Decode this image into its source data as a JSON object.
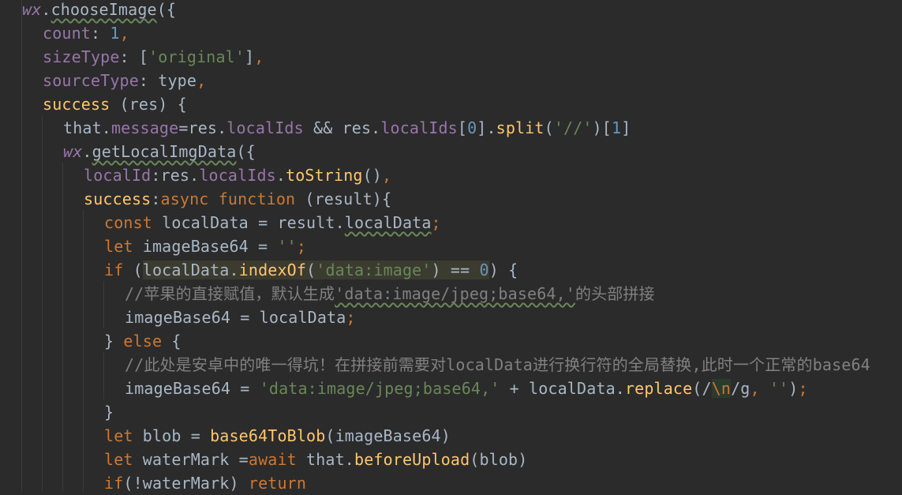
{
  "window": {
    "background": "#2b2b2b"
  },
  "colors": {
    "keyword": "#cc7832",
    "property": "#9876aa",
    "function": "#ffc66d",
    "number": "#6897bb",
    "string": "#6a8759",
    "comment": "#808080",
    "default": "#a9b7c6"
  },
  "code": {
    "lines": [
      {
        "name": "line-1",
        "tokens": [
          {
            "t": "wx",
            "c": "prop italic"
          },
          {
            "t": ".",
            "c": "plain"
          },
          {
            "t": "chooseImage",
            "c": "plain wavy"
          },
          {
            "t": "({",
            "c": "plain"
          }
        ]
      },
      {
        "name": "line-2",
        "tokens": [
          {
            "t": "count",
            "c": "prop"
          },
          {
            "t": ": ",
            "c": "plain"
          },
          {
            "t": "1",
            "c": "num"
          },
          {
            "t": ",",
            "c": "key"
          }
        ]
      },
      {
        "name": "line-3",
        "tokens": [
          {
            "t": "sizeType",
            "c": "prop"
          },
          {
            "t": ": [",
            "c": "plain"
          },
          {
            "t": "'original'",
            "c": "str"
          },
          {
            "t": "]",
            "c": "plain"
          },
          {
            "t": ",",
            "c": "key"
          }
        ]
      },
      {
        "name": "line-4",
        "tokens": [
          {
            "t": "sourceType",
            "c": "prop"
          },
          {
            "t": ": type",
            "c": "plain"
          },
          {
            "t": ",",
            "c": "key"
          }
        ]
      },
      {
        "name": "line-5",
        "tokens": [
          {
            "t": "success",
            "c": "fn"
          },
          {
            "t": " (res) {",
            "c": "plain"
          }
        ]
      },
      {
        "name": "line-6",
        "tokens": [
          {
            "t": "that.",
            "c": "plain"
          },
          {
            "t": "message",
            "c": "prop"
          },
          {
            "t": "=res.",
            "c": "plain"
          },
          {
            "t": "localIds",
            "c": "prop"
          },
          {
            "t": " && res.",
            "c": "plain"
          },
          {
            "t": "localIds",
            "c": "prop"
          },
          {
            "t": "[",
            "c": "plain"
          },
          {
            "t": "0",
            "c": "num"
          },
          {
            "t": "].",
            "c": "plain"
          },
          {
            "t": "split",
            "c": "fn"
          },
          {
            "t": "(",
            "c": "plain"
          },
          {
            "t": "'//'",
            "c": "str"
          },
          {
            "t": ")[",
            "c": "plain"
          },
          {
            "t": "1",
            "c": "num"
          },
          {
            "t": "]",
            "c": "plain"
          }
        ]
      },
      {
        "name": "line-7",
        "tokens": [
          {
            "t": "wx",
            "c": "prop italic"
          },
          {
            "t": ".",
            "c": "plain"
          },
          {
            "t": "getLocalImgData",
            "c": "plain wavy"
          },
          {
            "t": "({",
            "c": "plain"
          }
        ]
      },
      {
        "name": "line-8",
        "tokens": [
          {
            "t": "localId",
            "c": "prop"
          },
          {
            "t": ":res.",
            "c": "plain"
          },
          {
            "t": "localIds",
            "c": "prop"
          },
          {
            "t": ".",
            "c": "plain"
          },
          {
            "t": "toString",
            "c": "fn"
          },
          {
            "t": "()",
            "c": "plain"
          },
          {
            "t": ",",
            "c": "key"
          }
        ]
      },
      {
        "name": "line-9",
        "tokens": [
          {
            "t": "success",
            "c": "fn"
          },
          {
            "t": ":",
            "c": "plain"
          },
          {
            "t": "async function ",
            "c": "key"
          },
          {
            "t": "(result){",
            "c": "plain"
          }
        ]
      },
      {
        "name": "line-10",
        "tokens": [
          {
            "t": "const ",
            "c": "key"
          },
          {
            "t": "localData = result.",
            "c": "plain"
          },
          {
            "t": "localData",
            "c": "plain wavy"
          },
          {
            "t": ";",
            "c": "key"
          }
        ]
      },
      {
        "name": "line-11",
        "tokens": [
          {
            "t": "let ",
            "c": "key"
          },
          {
            "t": "imageBase64 = ",
            "c": "plain"
          },
          {
            "t": "''",
            "c": "str"
          },
          {
            "t": ";",
            "c": "key"
          }
        ]
      },
      {
        "name": "line-12",
        "tokens": [
          {
            "t": "if ",
            "c": "key"
          },
          {
            "t": "(",
            "c": "plain"
          },
          {
            "t": "localData.",
            "c": "plain hl"
          },
          {
            "t": "indexOf",
            "c": "fn hl"
          },
          {
            "t": "(",
            "c": "plain hl"
          },
          {
            "t": "'data:image'",
            "c": "str hl"
          },
          {
            "t": ") == ",
            "c": "plain hl"
          },
          {
            "t": "0",
            "c": "num hl"
          },
          {
            "t": ") {",
            "c": "plain"
          }
        ]
      },
      {
        "name": "line-13",
        "tokens": [
          {
            "t": "//苹果的直接赋值，默认生成",
            "c": "cmt"
          },
          {
            "t": "'data:image/jpeg;base64,'",
            "c": "cmt wavy"
          },
          {
            "t": "的头部拼接",
            "c": "cmt"
          }
        ]
      },
      {
        "name": "line-14",
        "tokens": [
          {
            "t": "imageBase64 = localData",
            "c": "plain"
          },
          {
            "t": ";",
            "c": "key"
          }
        ]
      },
      {
        "name": "line-15",
        "tokens": [
          {
            "t": "} ",
            "c": "plain"
          },
          {
            "t": "else ",
            "c": "key"
          },
          {
            "t": "{",
            "c": "plain"
          }
        ]
      },
      {
        "name": "line-16",
        "tokens": [
          {
            "t": "//此处是安卓中的唯一得坑！在拼接前需要对localData进行换行符的全局替换,此时一个正常的base64",
            "c": "cmt"
          }
        ]
      },
      {
        "name": "line-17",
        "tokens": [
          {
            "t": "imageBase64 = ",
            "c": "plain"
          },
          {
            "t": "'data:image/jpeg;base64,'",
            "c": "str"
          },
          {
            "t": " + localData.",
            "c": "plain"
          },
          {
            "t": "replace",
            "c": "fn"
          },
          {
            "t": "(/",
            "c": "plain"
          },
          {
            "t": "\\n",
            "c": "esc"
          },
          {
            "t": "/g",
            "c": "plain"
          },
          {
            "t": ", ",
            "c": "key"
          },
          {
            "t": "''",
            "c": "str"
          },
          {
            "t": ")",
            "c": "plain"
          },
          {
            "t": ";",
            "c": "key"
          }
        ]
      },
      {
        "name": "line-18",
        "tokens": [
          {
            "t": "}",
            "c": "plain"
          }
        ]
      },
      {
        "name": "line-19",
        "tokens": [
          {
            "t": "let ",
            "c": "key"
          },
          {
            "t": "blob = ",
            "c": "plain"
          },
          {
            "t": "base64ToBlob",
            "c": "fn"
          },
          {
            "t": "(imageBase64)",
            "c": "plain"
          }
        ]
      },
      {
        "name": "line-20",
        "tokens": [
          {
            "t": "let ",
            "c": "key"
          },
          {
            "t": "waterMark =",
            "c": "plain"
          },
          {
            "t": "await ",
            "c": "key"
          },
          {
            "t": "that.",
            "c": "plain"
          },
          {
            "t": "beforeUpload",
            "c": "fn"
          },
          {
            "t": "(blob)",
            "c": "plain"
          }
        ]
      },
      {
        "name": "line-21",
        "tokens": [
          {
            "t": "if",
            "c": "key"
          },
          {
            "t": "(!waterMark) ",
            "c": "plain"
          },
          {
            "t": "return",
            "c": "key"
          }
        ]
      }
    ]
  }
}
